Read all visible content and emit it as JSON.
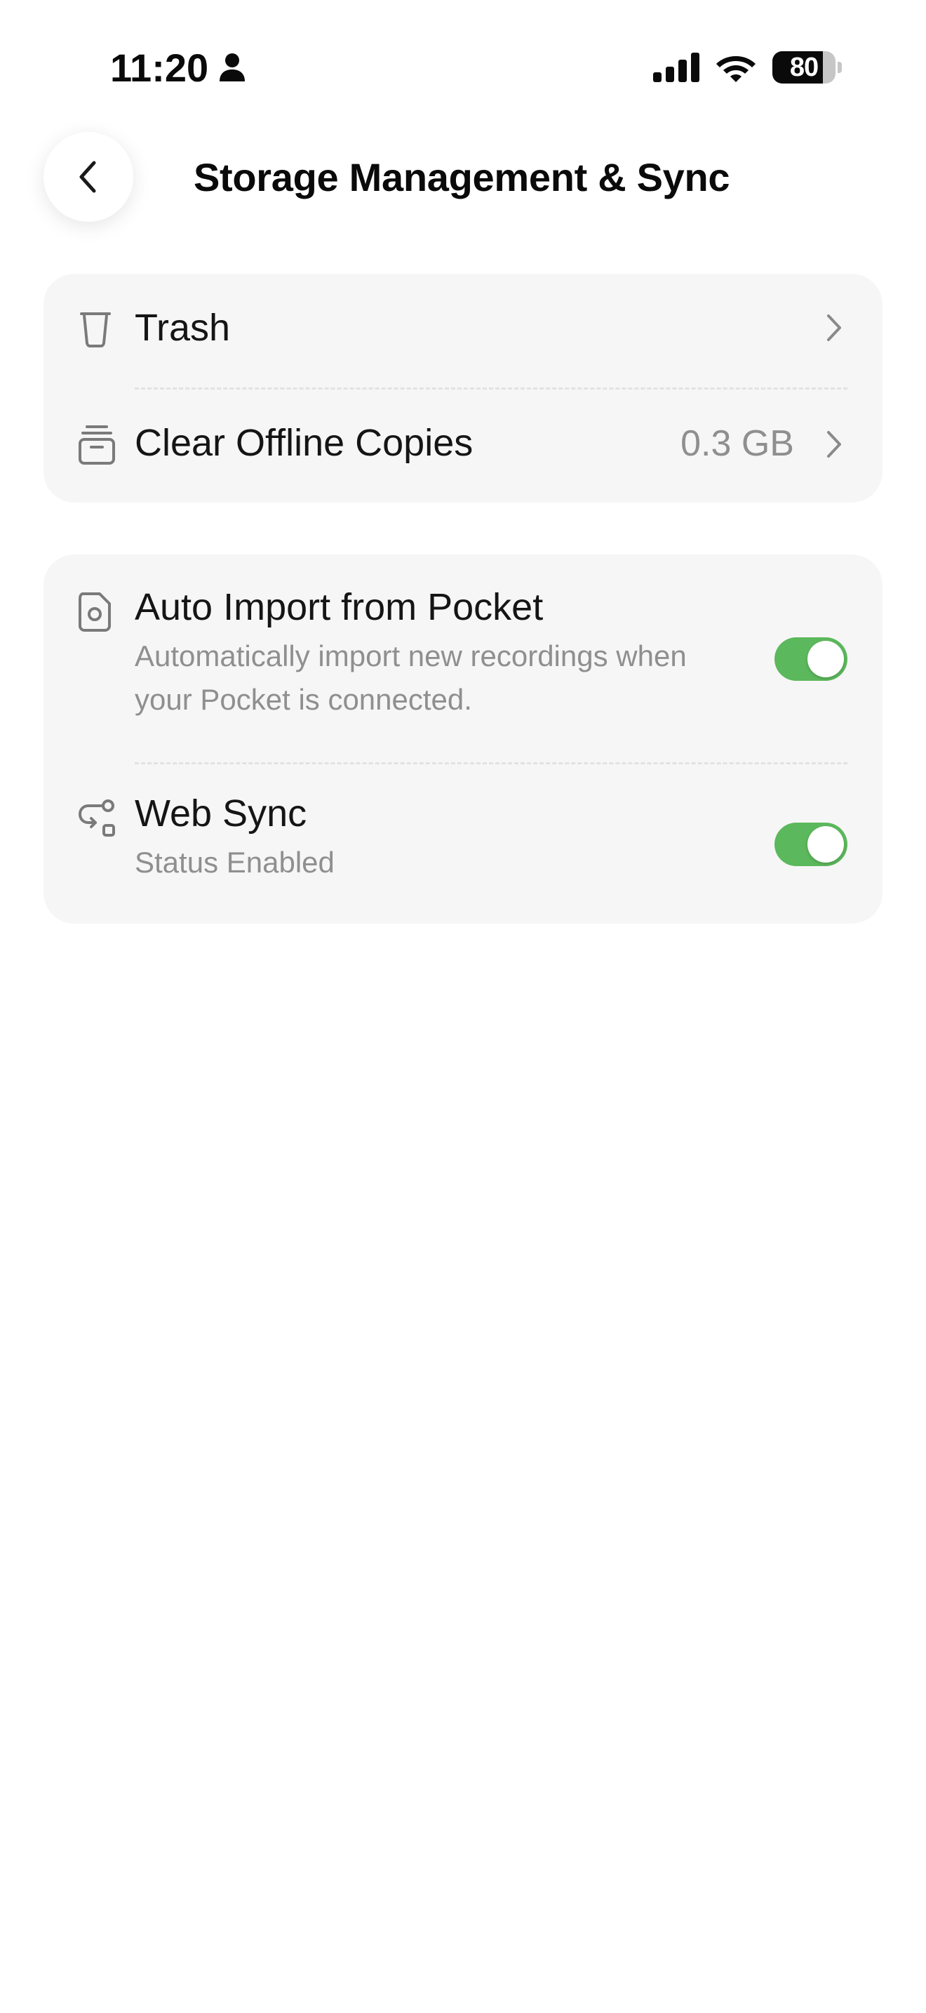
{
  "status_bar": {
    "time": "11:20",
    "battery_percent": 80,
    "battery_label": "80",
    "icons": [
      "person-icon",
      "signal-icon",
      "wifi-icon",
      "battery-icon"
    ]
  },
  "header": {
    "title": "Storage Management & Sync",
    "back_icon": "chevron-left-icon"
  },
  "storage_card": {
    "items": [
      {
        "label": "Trash",
        "icon": "trash-icon",
        "value": ""
      },
      {
        "label": "Clear Offline Copies",
        "icon": "archive-box-icon",
        "value": "0.3 GB"
      }
    ]
  },
  "sync_card": {
    "items": [
      {
        "label": "Auto Import from Pocket",
        "description_line1": "Automatically import new recordings when",
        "description_line2": "your Pocket is connected.",
        "icon": "document-circle-icon",
        "enabled": true
      },
      {
        "label": "Web Sync",
        "description_line1": "Status Enabled",
        "icon": "sync-route-icon",
        "enabled": true
      }
    ]
  },
  "colors": {
    "toggle_on": "#5CB85C",
    "card_background": "#F6F6F6",
    "secondary_text": "#8F8F8F",
    "primary_text": "#151515"
  }
}
